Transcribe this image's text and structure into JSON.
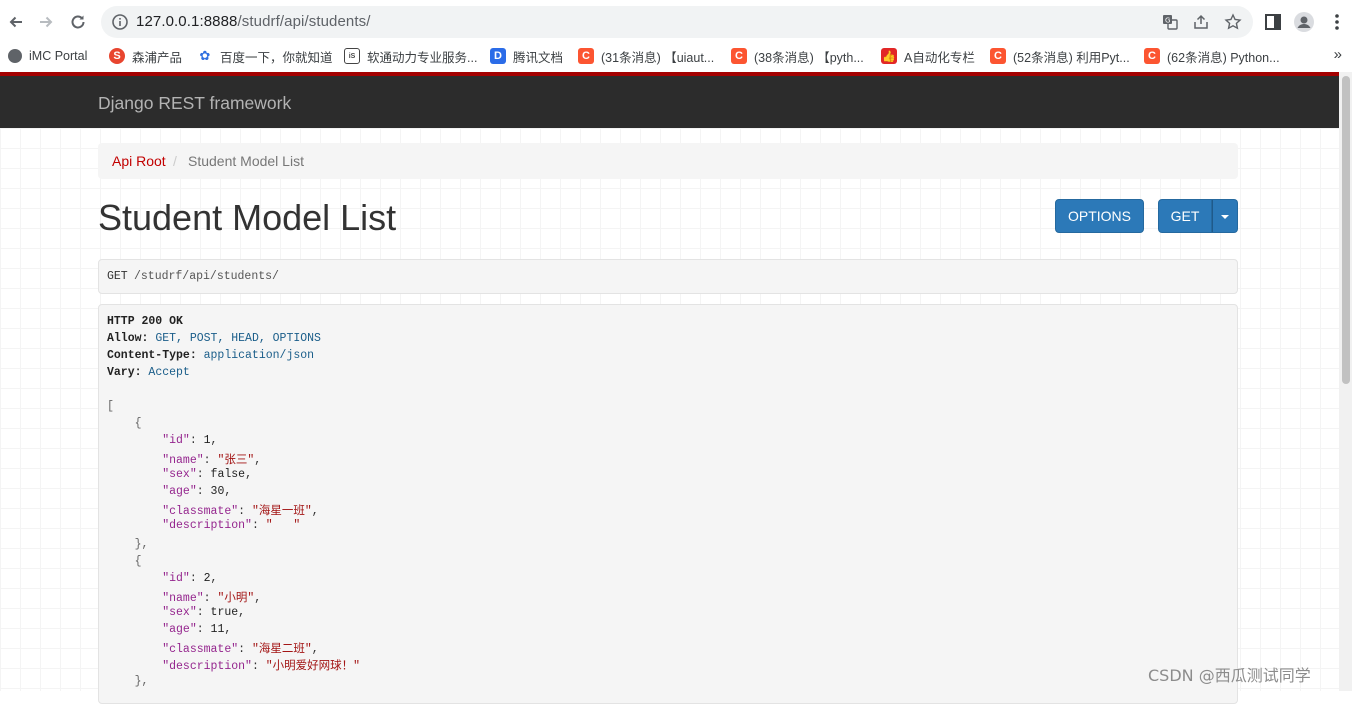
{
  "browser": {
    "url_host": "127.0.0.1:8888",
    "url_path": "/studrf/api/students/"
  },
  "bookmarks": [
    {
      "label": "iMC Portal",
      "icon": "globe-icon",
      "color": "#5f6368"
    },
    {
      "label": "森浦产品",
      "icon": "sumscope-icon",
      "color": "#e8452f"
    },
    {
      "label": "百度一下，你就知道",
      "icon": "baidu-paw-icon",
      "color": "#2f6fe0"
    },
    {
      "label": "软通动力专业服务...",
      "icon": "isoftstone-icon",
      "color": "#444444"
    },
    {
      "label": "腾讯文档",
      "icon": "tencent-docs-icon",
      "color": "#2b6ce8"
    },
    {
      "label": "(31条消息) 【uiaut...",
      "icon": "csdn-icon",
      "color": "#fc5531"
    },
    {
      "label": "(38条消息) 【pyth...",
      "icon": "csdn-icon",
      "color": "#fc5531"
    },
    {
      "label": "A自动化专栏",
      "icon": "thumbs-up-icon",
      "color": "#e22727"
    },
    {
      "label": "(52条消息) 利用Pyt...",
      "icon": "csdn-icon",
      "color": "#fc5531"
    },
    {
      "label": "(62条消息) Python...",
      "icon": "csdn-icon",
      "color": "#fc5531"
    }
  ],
  "bookmarks_more": "»",
  "drf": {
    "brand": "Django REST framework",
    "breadcrumb": {
      "root": "Api Root",
      "separator": "/",
      "current": "Student Model List"
    },
    "title": "Student Model List",
    "buttons": {
      "options": "OPTIONS",
      "get": "GET"
    },
    "request": {
      "method": "GET",
      "path": "/studrf/api/students/"
    },
    "response": {
      "status": "HTTP 200 OK",
      "headers": [
        {
          "key": "Allow:",
          "value": "GET, POST, HEAD, OPTIONS"
        },
        {
          "key": "Content-Type:",
          "value": "application/json"
        },
        {
          "key": "Vary:",
          "value": "Accept"
        }
      ],
      "records": [
        {
          "id": "1",
          "name": "\"张三\"",
          "sex": "false",
          "age": "30",
          "classmate": "\"海星一班\"",
          "description": "\"   \""
        },
        {
          "id": "2",
          "name": "\"小明\"",
          "sex": "true",
          "age": "11",
          "classmate": "\"海星二班\"",
          "description": "\"小明爱好网球！\""
        }
      ]
    }
  },
  "watermark": "CSDN @西瓜测试同学"
}
